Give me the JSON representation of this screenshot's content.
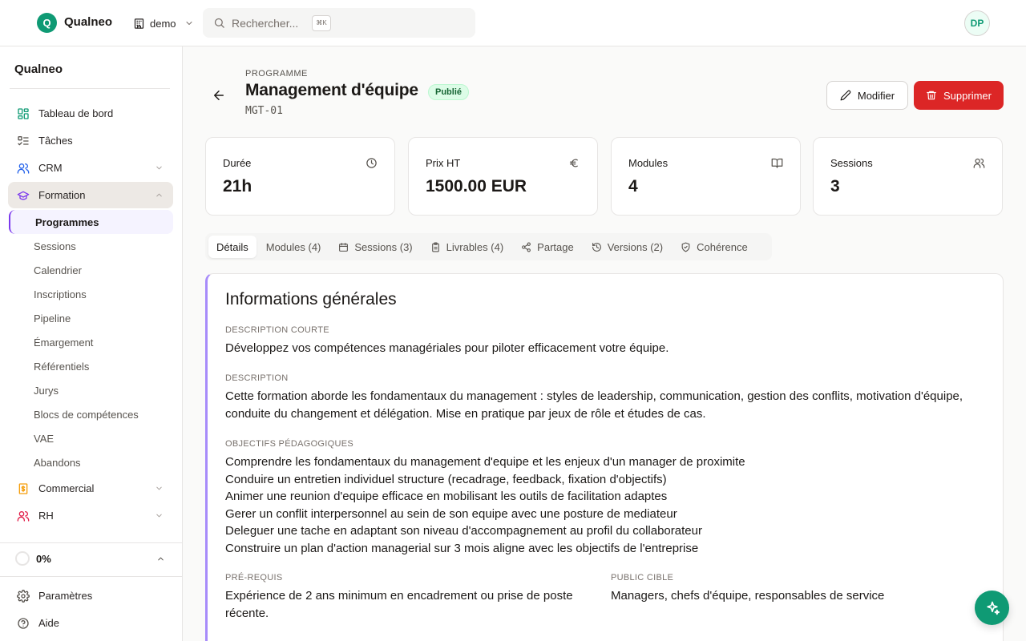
{
  "header": {
    "logo_letter": "Q",
    "app_name": "Qualneo",
    "workspace": "demo",
    "search_placeholder": "Rechercher...",
    "search_shortcut": "⌘K",
    "user_initials": "DP"
  },
  "sidebar": {
    "brand": "Qualneo",
    "items": [
      {
        "label": "Tableau de bord",
        "icon": "dashboard-icon",
        "color": "#0f9a74"
      },
      {
        "label": "Tâches",
        "icon": "checklist-icon",
        "color": "#57534e"
      },
      {
        "label": "CRM",
        "icon": "users-icon",
        "color": "#2563eb",
        "expandable": true
      },
      {
        "label": "Formation",
        "icon": "graduation-cap-icon",
        "color": "#7c3aed",
        "expandable": true,
        "expanded": true
      }
    ],
    "formation_sub": [
      "Programmes",
      "Sessions",
      "Calendrier",
      "Inscriptions",
      "Pipeline",
      "Émargement",
      "Référentiels",
      "Jurys",
      "Blocs de compétences",
      "VAE",
      "Abandons"
    ],
    "selected_sub": "Programmes",
    "items_after": [
      {
        "label": "Commercial",
        "icon": "invoice-icon",
        "color": "#f59e0b",
        "expandable": true
      },
      {
        "label": "RH",
        "icon": "users-icon",
        "color": "#e11d48",
        "expandable": true
      }
    ],
    "progress": "0%",
    "bottom": [
      {
        "label": "Paramètres",
        "icon": "gear-icon"
      },
      {
        "label": "Aide",
        "icon": "help-circle-icon"
      }
    ]
  },
  "page": {
    "eyebrow": "PROGRAMME",
    "title": "Management d'équipe",
    "status": "Publié",
    "code": "MGT-01",
    "edit_label": "Modifier",
    "delete_label": "Supprimer"
  },
  "stats": [
    {
      "label": "Durée",
      "value": "21h",
      "icon": "clock-icon"
    },
    {
      "label": "Prix HT",
      "value": "1500.00 EUR",
      "icon": "euro-icon"
    },
    {
      "label": "Modules",
      "value": "4",
      "icon": "book-open-icon"
    },
    {
      "label": "Sessions",
      "value": "3",
      "icon": "users-icon"
    }
  ],
  "tabs": [
    {
      "label": "Détails",
      "icon": null,
      "active": true
    },
    {
      "label": "Modules (4)",
      "icon": null
    },
    {
      "label": "Sessions (3)",
      "icon": "calendar-icon"
    },
    {
      "label": "Livrables (4)",
      "icon": "clipboard-icon"
    },
    {
      "label": "Partage",
      "icon": "share-icon"
    },
    {
      "label": "Versions (2)",
      "icon": "history-icon"
    },
    {
      "label": "Cohérence",
      "icon": "shield-check-icon"
    }
  ],
  "details": {
    "title": "Informations générales",
    "short_desc_label": "DESCRIPTION COURTE",
    "short_desc": "Développez vos compétences managériales pour piloter efficacement votre équipe.",
    "desc_label": "DESCRIPTION",
    "desc": "Cette formation aborde les fondamentaux du management : styles de leadership, communication, gestion des conflits, motivation d'équipe, conduite du changement et délégation. Mise en pratique par jeux de rôle et études de cas.",
    "objectives_label": "OBJECTIFS PÉDAGOGIQUES",
    "objectives": [
      "Comprendre les fondamentaux du management d'equipe et les enjeux d'un manager de proximite",
      "Conduire un entretien individuel structure (recadrage, feedback, fixation d'objectifs)",
      "Animer une reunion d'equipe efficace en mobilisant les outils de facilitation adaptes",
      "Gerer un conflit interpersonnel au sein de son equipe avec une posture de mediateur",
      "Deleguer une tache en adaptant son niveau d'accompagnement au profil du collaborateur",
      "Construire un plan d'action managerial sur 3 mois aligne avec les objectifs de l'entreprise"
    ],
    "prereq_label": "PRÉ-REQUIS",
    "prereq": "Expérience de 2 ans minimum en encadrement ou prise de poste récente.",
    "audience_label": "PUBLIC CIBLE",
    "audience": "Managers, chefs d'équipe, responsables de service"
  },
  "colors": {
    "brand": "#0f9a74",
    "danger": "#dc2626",
    "accent": "#7c3aed"
  }
}
